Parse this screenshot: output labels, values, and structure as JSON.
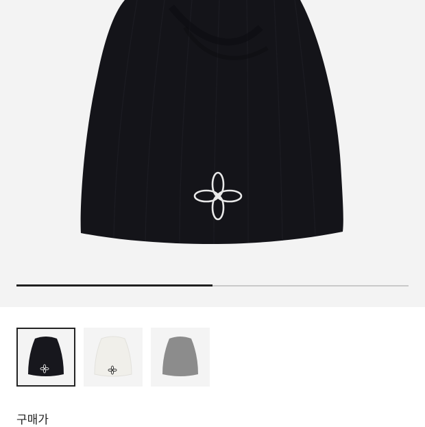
{
  "product": {
    "name": "",
    "gallery": {
      "slide_progress": 0.5,
      "thumbnails": [
        {
          "color_name": "black",
          "hex": "#17171d",
          "selected": true
        },
        {
          "color_name": "white",
          "hex": "#f0efea",
          "selected": false
        },
        {
          "color_name": "gray",
          "hex": "#8c8c8c",
          "selected": false
        }
      ]
    },
    "logo_color": "#e9e9e9"
  },
  "purchase": {
    "price_label": "구매가"
  },
  "colors": {
    "hero_background": "#f3f3f3",
    "beanie_black": "#141419"
  }
}
